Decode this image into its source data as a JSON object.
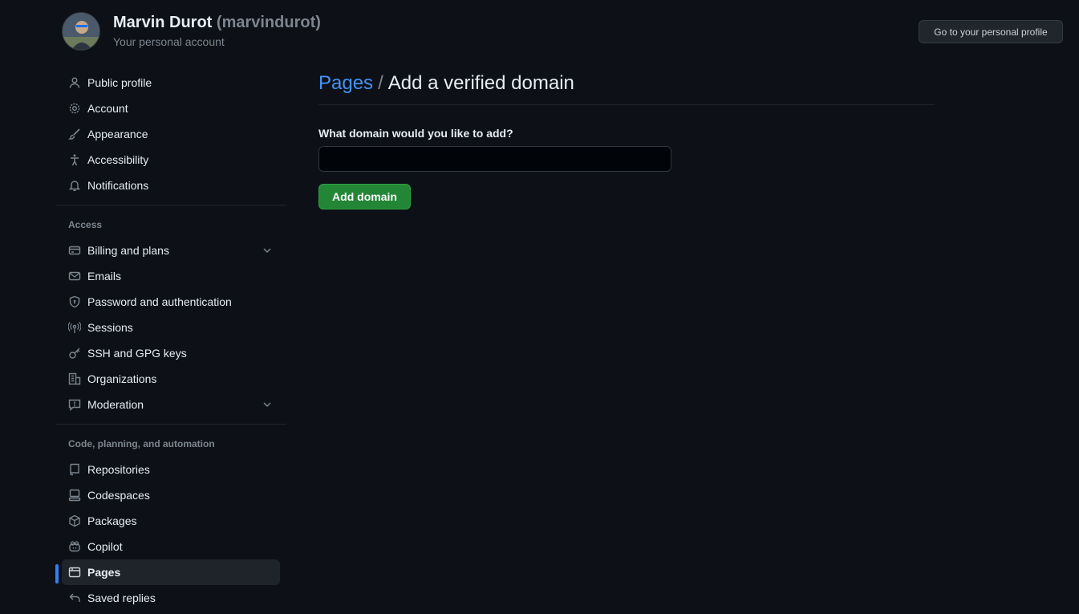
{
  "account": {
    "display_name": "Marvin Durot",
    "login": "(marvindurot)",
    "subtitle": "Your personal account",
    "profile_button": "Go to your personal profile"
  },
  "sidebar": {
    "group1": [
      {
        "label": "Public profile",
        "icon": "person-icon"
      },
      {
        "label": "Account",
        "icon": "gear-icon"
      },
      {
        "label": "Appearance",
        "icon": "paintbrush-icon"
      },
      {
        "label": "Accessibility",
        "icon": "accessibility-icon"
      },
      {
        "label": "Notifications",
        "icon": "bell-icon"
      }
    ],
    "access_title": "Access",
    "group2": [
      {
        "label": "Billing and plans",
        "icon": "credit-card-icon",
        "expandable": true
      },
      {
        "label": "Emails",
        "icon": "mail-icon"
      },
      {
        "label": "Password and authentication",
        "icon": "shield-lock-icon"
      },
      {
        "label": "Sessions",
        "icon": "broadcast-icon"
      },
      {
        "label": "SSH and GPG keys",
        "icon": "key-icon"
      },
      {
        "label": "Organizations",
        "icon": "organization-icon"
      },
      {
        "label": "Moderation",
        "icon": "report-icon",
        "expandable": true
      }
    ],
    "code_title": "Code, planning, and automation",
    "group3": [
      {
        "label": "Repositories",
        "icon": "repo-icon"
      },
      {
        "label": "Codespaces",
        "icon": "codespaces-icon"
      },
      {
        "label": "Packages",
        "icon": "package-icon"
      },
      {
        "label": "Copilot",
        "icon": "copilot-icon"
      },
      {
        "label": "Pages",
        "icon": "browser-icon",
        "active": true
      },
      {
        "label": "Saved replies",
        "icon": "reply-icon"
      }
    ]
  },
  "main": {
    "breadcrumb_link": "Pages",
    "breadcrumb_sep": "/",
    "title": "Add a verified domain",
    "field_label": "What domain would you like to add?",
    "input_value": "",
    "submit_label": "Add domain"
  },
  "colors": {
    "background": "#0d1117",
    "accent": "#2f81f7",
    "link": "#4493f8",
    "primary_button": "#238636"
  }
}
